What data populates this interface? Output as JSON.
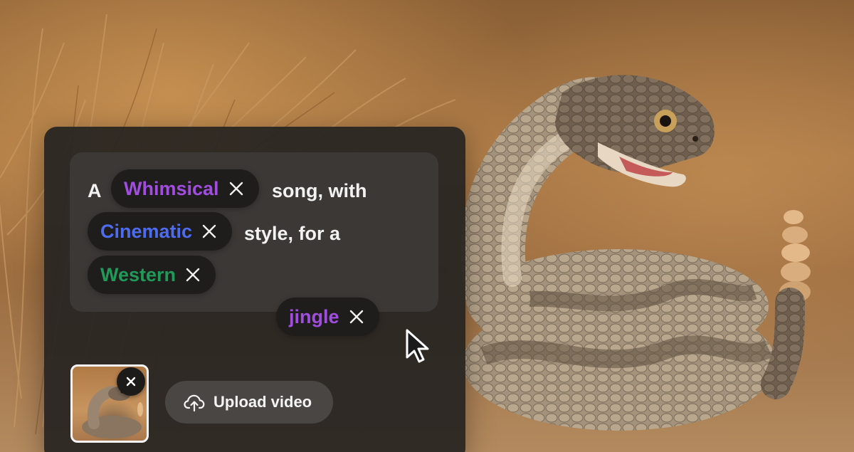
{
  "prompt": {
    "word_a": "A",
    "chip_1": {
      "label": "Whimsical",
      "color": "#a04de0"
    },
    "word_song": "song, with",
    "chip_2": {
      "label": "Cinematic",
      "color": "#4e6cf0"
    },
    "word_style": "style, for a",
    "chip_3": {
      "label": "Western",
      "color": "#1f9a58"
    },
    "chip_4": {
      "label": "jingle",
      "color": "#a04de0"
    },
    "remove_icon": "close-icon"
  },
  "attachment": {
    "remove_icon": "close-icon",
    "upload_label": "Upload video",
    "upload_icon": "cloud-upload-icon"
  },
  "colors": {
    "panel": "#262321",
    "prompt_box": "#3b3836",
    "chip_bg": "#1f1d1c",
    "upload_bg": "#4a4643"
  }
}
